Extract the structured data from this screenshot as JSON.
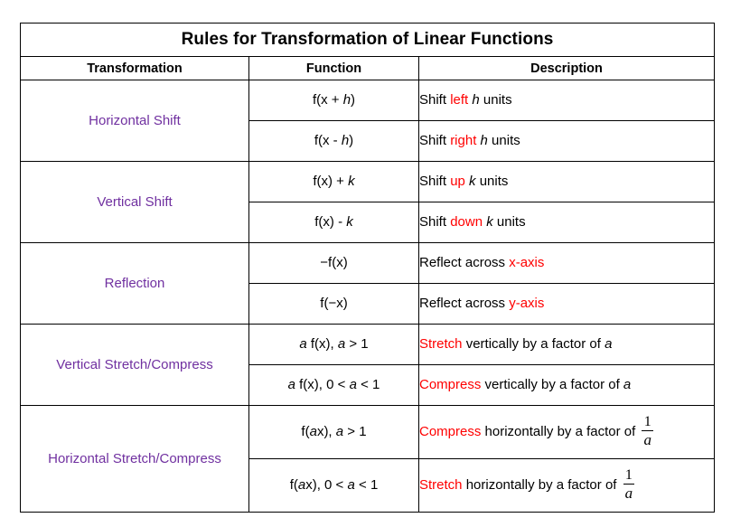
{
  "table": {
    "title": "Rules for Transformation of Linear Functions",
    "headers": {
      "transformation": "Transformation",
      "function": "Function",
      "description": "Description"
    },
    "colors": {
      "transformation_label": "#7030A0",
      "emphasis": "#FF0000",
      "text": "#000000",
      "border": "#000000",
      "background": "#FFFFFF"
    },
    "groups": [
      {
        "label": "Horizontal Shift",
        "rows": [
          {
            "function_plain": "f(x + h)",
            "function_parts": [
              {
                "text": "f(x + ",
                "style": "normal"
              },
              {
                "text": "h",
                "style": "italic"
              },
              {
                "text": ")",
                "style": "normal"
              }
            ],
            "description_plain": "Shift left h units",
            "description_parts": [
              {
                "text": "Shift ",
                "style": "normal"
              },
              {
                "text": "left",
                "style": "red"
              },
              {
                "text": " ",
                "style": "normal"
              },
              {
                "text": "h",
                "style": "italic"
              },
              {
                "text": " units",
                "style": "normal"
              }
            ]
          },
          {
            "function_plain": "f(x  - h)",
            "function_parts": [
              {
                "text": "f(x  - ",
                "style": "normal"
              },
              {
                "text": "h",
                "style": "italic"
              },
              {
                "text": ")",
                "style": "normal"
              }
            ],
            "description_plain": "Shift right h units",
            "description_parts": [
              {
                "text": "Shift ",
                "style": "normal"
              },
              {
                "text": "right",
                "style": "red"
              },
              {
                "text": " ",
                "style": "normal"
              },
              {
                "text": "h",
                "style": "italic"
              },
              {
                "text": " units",
                "style": "normal"
              }
            ]
          }
        ]
      },
      {
        "label": "Vertical Shift",
        "rows": [
          {
            "function_plain": "f(x) + k",
            "function_parts": [
              {
                "text": "f(x) + ",
                "style": "normal"
              },
              {
                "text": "k",
                "style": "italic"
              }
            ],
            "description_plain": "Shift up k units",
            "description_parts": [
              {
                "text": "Shift ",
                "style": "normal"
              },
              {
                "text": "up",
                "style": "red"
              },
              {
                "text": " ",
                "style": "normal"
              },
              {
                "text": "k",
                "style": "italic"
              },
              {
                "text": " units",
                "style": "normal"
              }
            ]
          },
          {
            "function_plain": "f(x) - k",
            "function_parts": [
              {
                "text": "f(x) - ",
                "style": "normal"
              },
              {
                "text": "k",
                "style": "italic"
              }
            ],
            "description_plain": "Shift down k units",
            "description_parts": [
              {
                "text": "Shift ",
                "style": "normal"
              },
              {
                "text": "down",
                "style": "red"
              },
              {
                "text": " ",
                "style": "normal"
              },
              {
                "text": "k",
                "style": "italic"
              },
              {
                "text": " units",
                "style": "normal"
              }
            ]
          }
        ]
      },
      {
        "label": "Reflection",
        "rows": [
          {
            "function_plain": "−f(x)",
            "function_parts": [
              {
                "text": "−f(x)",
                "style": "normal"
              }
            ],
            "description_plain": "Reflect across x-axis",
            "description_parts": [
              {
                "text": "Reflect across ",
                "style": "normal"
              },
              {
                "text": "x-axis",
                "style": "red"
              }
            ]
          },
          {
            "function_plain": "f(−x)",
            "function_parts": [
              {
                "text": "f(−x)",
                "style": "normal"
              }
            ],
            "description_plain": "Reflect across y-axis",
            "description_parts": [
              {
                "text": "Reflect across ",
                "style": "normal"
              },
              {
                "text": "y-axis",
                "style": "red"
              }
            ]
          }
        ]
      },
      {
        "label": "Vertical Stretch/Compress",
        "rows": [
          {
            "function_plain": "a f(x), a > 1",
            "function_parts": [
              {
                "text": "a",
                "style": "italic"
              },
              {
                "text": " f(x), ",
                "style": "normal"
              },
              {
                "text": "a",
                "style": "italic"
              },
              {
                "text": " > 1",
                "style": "normal"
              }
            ],
            "description_plain": "Stretch vertically by a factor of a",
            "description_parts": [
              {
                "text": "Stretch",
                "style": "red"
              },
              {
                "text": " vertically by a factor of ",
                "style": "normal"
              },
              {
                "text": "a",
                "style": "italic"
              }
            ]
          },
          {
            "function_plain": "a f(x), 0 < a < 1",
            "function_parts": [
              {
                "text": "a",
                "style": "italic"
              },
              {
                "text": " f(x), 0 < ",
                "style": "normal"
              },
              {
                "text": "a",
                "style": "italic"
              },
              {
                "text": " < 1",
                "style": "normal"
              }
            ],
            "description_plain": "Compress vertically by a factor of a",
            "description_parts": [
              {
                "text": "Compress",
                "style": "red"
              },
              {
                "text": " vertically by a factor of ",
                "style": "normal"
              },
              {
                "text": "a",
                "style": "italic"
              }
            ]
          }
        ]
      },
      {
        "label": "Horizontal Stretch/Compress",
        "rows": [
          {
            "function_plain": "f(ax), a > 1",
            "function_parts": [
              {
                "text": "f(",
                "style": "normal"
              },
              {
                "text": "a",
                "style": "italic"
              },
              {
                "text": "x), ",
                "style": "normal"
              },
              {
                "text": "a",
                "style": "italic"
              },
              {
                "text": " > 1",
                "style": "normal"
              }
            ],
            "description_plain": "Compress horizontally by a factor of 1/a",
            "description_parts": [
              {
                "text": "Compress",
                "style": "red"
              },
              {
                "text": " horizontally by a factor of ",
                "style": "normal"
              },
              {
                "text": "1/a",
                "style": "fraction",
                "numerator": "1",
                "denominator": "a"
              }
            ]
          },
          {
            "function_plain": "f(ax), 0 < a < 1",
            "function_parts": [
              {
                "text": "f(",
                "style": "normal"
              },
              {
                "text": "a",
                "style": "italic"
              },
              {
                "text": "x), 0 < ",
                "style": "normal"
              },
              {
                "text": "a",
                "style": "italic"
              },
              {
                "text": " < 1",
                "style": "normal"
              }
            ],
            "description_plain": "Stretch horizontally by a factor of 1/a",
            "description_parts": [
              {
                "text": "Stretch",
                "style": "red"
              },
              {
                "text": " horizontally by a factor of ",
                "style": "normal"
              },
              {
                "text": "1/a",
                "style": "fraction",
                "numerator": "1",
                "denominator": "a"
              }
            ]
          }
        ]
      }
    ]
  }
}
